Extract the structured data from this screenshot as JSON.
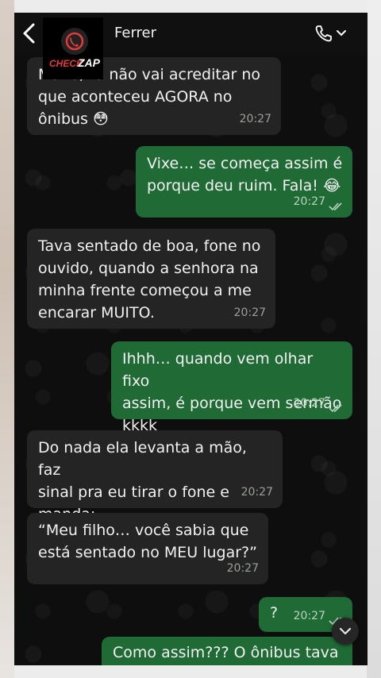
{
  "header": {
    "contact_name": "Ferrer",
    "logo_top": "CHECK",
    "logo_bottom": "ZAP"
  },
  "messages": [
    {
      "direction": "in",
      "text": "Mano, tu não vai acreditar no\nque aconteceu AGORA no\nônibus 😳",
      "time": "20:27"
    },
    {
      "direction": "out",
      "text": "Vixe… se começa assim é\nporque deu ruim. Fala! 😂",
      "time": "20:27",
      "status": "read"
    },
    {
      "direction": "in",
      "text": "Tava sentado de boa, fone no\nouvido, quando a senhora na\nminha frente começou a me\nencarar MUITO.",
      "time": "20:27"
    },
    {
      "direction": "out",
      "text": "Ihhh… quando vem olhar fixo\nassim, é porque vem sermão\nkkkk",
      "time": "20:27",
      "status": "read"
    },
    {
      "direction": "in",
      "text": "Do nada ela levanta a mão, faz\nsinal pra eu tirar o fone e\nmanda:",
      "time": "20:27"
    },
    {
      "direction": "in",
      "text": "“Meu filho… você sabia que\nestá sentado no MEU lugar?”",
      "time": "20:27"
    },
    {
      "direction": "out",
      "text": "?",
      "time": "20:27",
      "status": "read"
    },
    {
      "direction": "out",
      "text": "Como assim??? O ônibus tava",
      "time": "",
      "status": ""
    }
  ],
  "colors": {
    "incoming": "#242424",
    "outgoing": "#1f6a35",
    "header": "#101010"
  },
  "icons": [
    "back-arrow-icon",
    "phone-icon",
    "chevron-down-icon",
    "double-check-icon",
    "scroll-down-icon"
  ]
}
